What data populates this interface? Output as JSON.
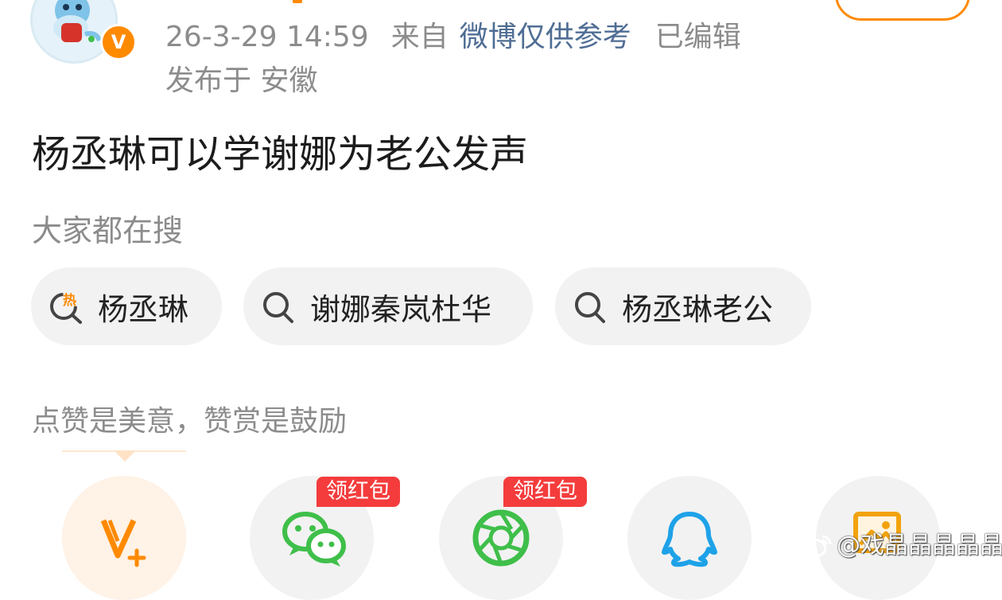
{
  "post": {
    "timestamp": "26-3-29 14:59",
    "from_label": "来自",
    "source": "微博仅供参考",
    "edited": "已编辑",
    "location": "发布于 安徽",
    "text": "杨丞琳可以学谢娜为老公发声"
  },
  "hot_search": {
    "label": "大家都在搜",
    "items": [
      {
        "icon": "hot-search-icon",
        "label": "杨丞琳"
      },
      {
        "icon": "search-icon",
        "label": "谢娜秦岚杜华"
      },
      {
        "icon": "search-icon",
        "label": "杨丞琳老公"
      }
    ]
  },
  "reward_tip": "点赞是美意，赞赏是鼓励",
  "share": {
    "items": [
      {
        "name": "v-plus",
        "icon": "v-plus-icon"
      },
      {
        "name": "wechat",
        "icon": "wechat-icon",
        "badge": "领红包"
      },
      {
        "name": "moments",
        "icon": "moments-icon",
        "badge": "领红包"
      },
      {
        "name": "qq",
        "icon": "qq-icon"
      },
      {
        "name": "album",
        "icon": "album-icon"
      }
    ]
  },
  "watermark": "@戏晶晶晶晶晶",
  "colors": {
    "accent": "#ff8a00",
    "link": "#4f6d94",
    "wechat": "#3fbf4a",
    "qq": "#1ea2e8",
    "red_badge": "#f43c3c"
  }
}
